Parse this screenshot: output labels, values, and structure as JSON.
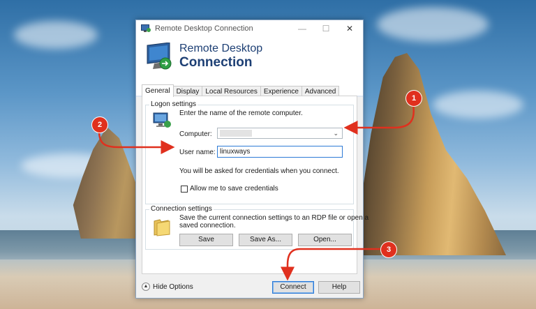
{
  "window": {
    "title": "Remote Desktop Connection",
    "banner_line1": "Remote Desktop",
    "banner_line2": "Connection"
  },
  "tabs": [
    {
      "label": "General",
      "active": true
    },
    {
      "label": "Display",
      "active": false
    },
    {
      "label": "Local Resources",
      "active": false
    },
    {
      "label": "Experience",
      "active": false
    },
    {
      "label": "Advanced",
      "active": false
    }
  ],
  "logon": {
    "group_label": "Logon settings",
    "instruction": "Enter the name of the remote computer.",
    "computer_label": "Computer:",
    "computer_value": "",
    "username_label": "User name:",
    "username_value": "linuxways",
    "credentials_note": "You will be asked for credentials when you connect.",
    "save_credentials_label": "Allow me to save credentials",
    "save_credentials_checked": false
  },
  "connection": {
    "group_label": "Connection settings",
    "description_line1": "Save the current connection settings to an RDP file or open a",
    "description_line2": "saved connection.",
    "save_label": "Save",
    "save_as_label": "Save As...",
    "open_label": "Open..."
  },
  "footer": {
    "hide_options_label": "Hide Options",
    "connect_label": "Connect",
    "help_label": "Help"
  },
  "annotations": {
    "badge1": "1",
    "badge2": "2",
    "badge3": "3",
    "color": "#e0301e"
  }
}
